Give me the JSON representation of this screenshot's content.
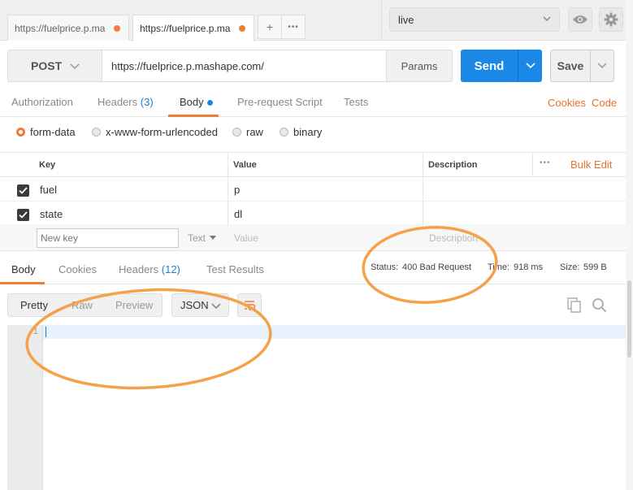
{
  "tabs": [
    {
      "label": "https://fuelprice.p.ma"
    },
    {
      "label": "https://fuelprice.p.ma"
    }
  ],
  "tab_actions": {
    "add": "+",
    "more": "•••"
  },
  "environment": {
    "selected": "live"
  },
  "request": {
    "method": "POST",
    "url": "https://fuelprice.p.mashape.com/",
    "params_label": "Params",
    "send_label": "Send",
    "save_label": "Save"
  },
  "request_tabs": {
    "authorization": "Authorization",
    "headers": "Headers",
    "headers_count": "(3)",
    "body": "Body",
    "prerequest": "Pre-request Script",
    "tests": "Tests",
    "cookies": "Cookies",
    "code": "Code"
  },
  "body_modes": [
    "form-data",
    "x-www-form-urlencoded",
    "raw",
    "binary"
  ],
  "table": {
    "headers": {
      "key": "Key",
      "value": "Value",
      "description": "Description"
    },
    "more": "•••",
    "bulk_edit": "Bulk Edit",
    "rows": [
      {
        "key": "fuel",
        "value": "p"
      },
      {
        "key": "state",
        "value": "dl"
      }
    ],
    "new_row": {
      "key_placeholder": "New key",
      "type": "Text",
      "value_placeholder": "Value",
      "description_placeholder": "Description"
    }
  },
  "response_tabs": {
    "body": "Body",
    "cookies": "Cookies",
    "headers": "Headers",
    "headers_count": "(12)",
    "test_results": "Test Results"
  },
  "response_meta": {
    "status_label": "Status:",
    "status_value": "400 Bad Request",
    "time_label": "Time:",
    "time_value": "918 ms",
    "size_label": "Size:",
    "size_value": "599 B"
  },
  "viewer": {
    "modes": [
      "Pretty",
      "Raw",
      "Preview"
    ],
    "format": "JSON",
    "line_number": "1"
  },
  "colors": {
    "accent": "#f07c3a",
    "send": "#1a88e6",
    "link": "#1a7ad6",
    "annotation": "#f5a04a"
  }
}
